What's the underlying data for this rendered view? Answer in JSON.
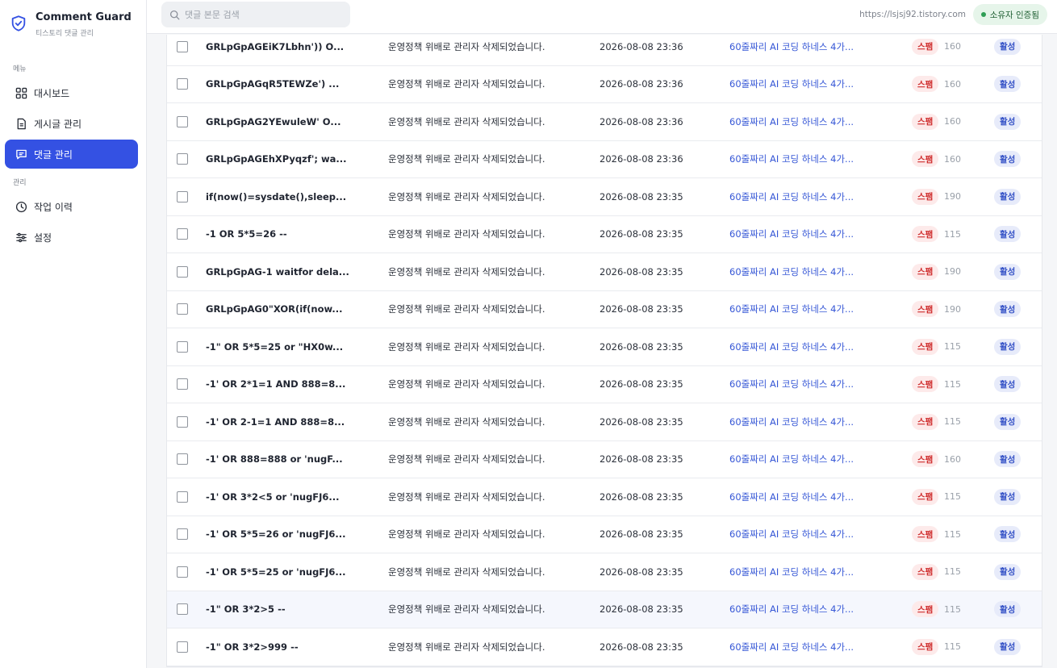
{
  "app": {
    "title": "Comment Guard",
    "subtitle": "티스토리 댓글 관리"
  },
  "sidebar": {
    "menu_label": "메뉴",
    "menu_items": [
      {
        "label": "대시보드",
        "icon": "dashboard-icon"
      },
      {
        "label": "게시글 관리",
        "icon": "document-icon"
      },
      {
        "label": "댓글 관리",
        "icon": "comment-icon",
        "active": true
      }
    ],
    "admin_label": "관리",
    "admin_items": [
      {
        "label": "작업 이력",
        "icon": "clock-icon"
      },
      {
        "label": "설정",
        "icon": "sliders-icon"
      }
    ]
  },
  "header": {
    "search_placeholder": "댓글 본문 검색",
    "site_url": "https://lsjsj92.tistory.com",
    "owner_badge": "소유자 인증됨"
  },
  "colors": {
    "accent": "#3451e3",
    "spam_bg": "#fdeaea",
    "spam_text": "#cf2d2d",
    "status_bg": "#e7ebfa",
    "link": "#3657d6"
  },
  "comments": [
    {
      "author": "GRLpGpAGEiK7Lbhn')) O...",
      "content": "운영정책 위배로 관리자 삭제되었습니다.",
      "date": "2026-08-08 23:36",
      "post": "60줄짜리 AI 코딩 하네스 4가...",
      "tag": "스팸",
      "score": "160",
      "status": "활성"
    },
    {
      "author": "GRLpGpAGqR5TEWZe') ...",
      "content": "운영정책 위배로 관리자 삭제되었습니다.",
      "date": "2026-08-08 23:36",
      "post": "60줄짜리 AI 코딩 하네스 4가...",
      "tag": "스팸",
      "score": "160",
      "status": "활성"
    },
    {
      "author": "GRLpGpAG2YEwuleW' O...",
      "content": "운영정책 위배로 관리자 삭제되었습니다.",
      "date": "2026-08-08 23:36",
      "post": "60줄짜리 AI 코딩 하네스 4가...",
      "tag": "스팸",
      "score": "160",
      "status": "활성"
    },
    {
      "author": "GRLpGpAGEhXPyqzf'; wa...",
      "content": "운영정책 위배로 관리자 삭제되었습니다.",
      "date": "2026-08-08 23:36",
      "post": "60줄짜리 AI 코딩 하네스 4가...",
      "tag": "스팸",
      "score": "160",
      "status": "활성"
    },
    {
      "author": "if(now()=sysdate(),sleep...",
      "content": "운영정책 위배로 관리자 삭제되었습니다.",
      "date": "2026-08-08 23:35",
      "post": "60줄짜리 AI 코딩 하네스 4가...",
      "tag": "스팸",
      "score": "190",
      "status": "활성"
    },
    {
      "author": "-1 OR 5*5=26 --",
      "content": "운영정책 위배로 관리자 삭제되었습니다.",
      "date": "2026-08-08 23:35",
      "post": "60줄짜리 AI 코딩 하네스 4가...",
      "tag": "스팸",
      "score": "115",
      "status": "활성"
    },
    {
      "author": "GRLpGpAG-1 waitfor dela...",
      "content": "운영정책 위배로 관리자 삭제되었습니다.",
      "date": "2026-08-08 23:35",
      "post": "60줄짜리 AI 코딩 하네스 4가...",
      "tag": "스팸",
      "score": "190",
      "status": "활성"
    },
    {
      "author": "GRLpGpAG0\"XOR(if(now...",
      "content": "운영정책 위배로 관리자 삭제되었습니다.",
      "date": "2026-08-08 23:35",
      "post": "60줄짜리 AI 코딩 하네스 4가...",
      "tag": "스팸",
      "score": "190",
      "status": "활성"
    },
    {
      "author": "-1\" OR 5*5=25 or \"HX0w...",
      "content": "운영정책 위배로 관리자 삭제되었습니다.",
      "date": "2026-08-08 23:35",
      "post": "60줄짜리 AI 코딩 하네스 4가...",
      "tag": "스팸",
      "score": "115",
      "status": "활성"
    },
    {
      "author": "-1' OR 2*1=1 AND 888=8...",
      "content": "운영정책 위배로 관리자 삭제되었습니다.",
      "date": "2026-08-08 23:35",
      "post": "60줄짜리 AI 코딩 하네스 4가...",
      "tag": "스팸",
      "score": "115",
      "status": "활성"
    },
    {
      "author": "-1' OR 2-1=1 AND 888=8...",
      "content": "운영정책 위배로 관리자 삭제되었습니다.",
      "date": "2026-08-08 23:35",
      "post": "60줄짜리 AI 코딩 하네스 4가...",
      "tag": "스팸",
      "score": "115",
      "status": "활성"
    },
    {
      "author": "-1' OR 888=888 or 'nugF...",
      "content": "운영정책 위배로 관리자 삭제되었습니다.",
      "date": "2026-08-08 23:35",
      "post": "60줄짜리 AI 코딩 하네스 4가...",
      "tag": "스팸",
      "score": "160",
      "status": "활성"
    },
    {
      "author": "-1' OR 3*2<5 or 'nugFJ6...",
      "content": "운영정책 위배로 관리자 삭제되었습니다.",
      "date": "2026-08-08 23:35",
      "post": "60줄짜리 AI 코딩 하네스 4가...",
      "tag": "스팸",
      "score": "115",
      "status": "활성"
    },
    {
      "author": "-1' OR 5*5=26 or 'nugFJ6...",
      "content": "운영정책 위배로 관리자 삭제되었습니다.",
      "date": "2026-08-08 23:35",
      "post": "60줄짜리 AI 코딩 하네스 4가...",
      "tag": "스팸",
      "score": "115",
      "status": "활성"
    },
    {
      "author": "-1' OR 5*5=25 or 'nugFJ6...",
      "content": "운영정책 위배로 관리자 삭제되었습니다.",
      "date": "2026-08-08 23:35",
      "post": "60줄짜리 AI 코딩 하네스 4가...",
      "tag": "스팸",
      "score": "115",
      "status": "활성"
    },
    {
      "author": "-1\" OR 3*2>5 --",
      "content": "운영정책 위배로 관리자 삭제되었습니다.",
      "date": "2026-08-08 23:35",
      "post": "60줄짜리 AI 코딩 하네스 4가...",
      "tag": "스팸",
      "score": "115",
      "status": "활성",
      "hover": true
    },
    {
      "author": "-1\" OR 3*2>999 --",
      "content": "운영정책 위배로 관리자 삭제되었습니다.",
      "date": "2026-08-08 23:35",
      "post": "60줄짜리 AI 코딩 하네스 4가...",
      "tag": "스팸",
      "score": "115",
      "status": "활성"
    }
  ]
}
